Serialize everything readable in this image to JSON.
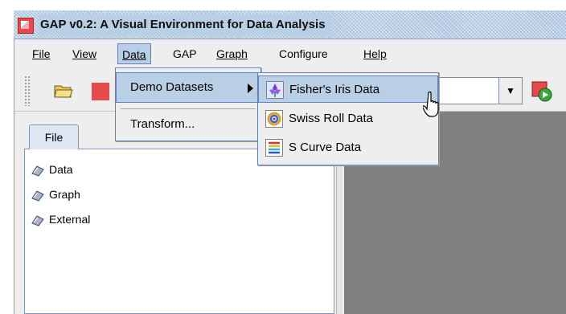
{
  "window": {
    "title": "GAP v0.2: A Visual Environment for Data Analysis"
  },
  "menubar": {
    "items": [
      {
        "label": "File"
      },
      {
        "label": "View"
      },
      {
        "label": "Data"
      },
      {
        "label": "GAP"
      },
      {
        "label": "Graph"
      },
      {
        "label": "Configure"
      },
      {
        "label": "Help"
      }
    ],
    "active": "Data"
  },
  "toolbar": {
    "icons": [
      "open-folder-icon",
      "gap-logo-icon",
      "dropdown-arrow-icon",
      "run-icon"
    ],
    "combo_value": ""
  },
  "left_panel": {
    "tab_label": "File",
    "tree": [
      {
        "label": "Data",
        "icon": "tree-node-icon"
      },
      {
        "label": "Graph",
        "icon": "tree-node-icon"
      },
      {
        "label": "External",
        "icon": "tree-node-icon"
      }
    ]
  },
  "data_menu": {
    "items": [
      {
        "label": "Demo Datasets",
        "has_submenu": true
      },
      {
        "label": "Transform..."
      }
    ]
  },
  "demo_datasets_menu": {
    "items": [
      {
        "label": "Fisher's Iris Data",
        "icon": "iris-icon"
      },
      {
        "label": "Swiss Roll Data",
        "icon": "swiss-roll-icon"
      },
      {
        "label": "S Curve Data",
        "icon": "s-curve-icon"
      }
    ]
  },
  "colors": {
    "selection": "#b8cfe5",
    "selection_border": "#6382bf",
    "panel_bg": "#808080",
    "accent_red": "#e84b4b"
  }
}
